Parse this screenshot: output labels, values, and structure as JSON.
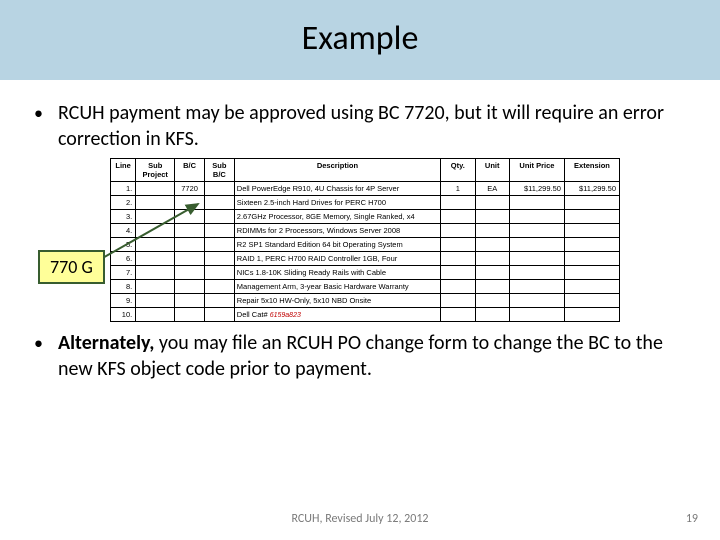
{
  "title": "Example",
  "bullets": {
    "b1": "RCUH payment may be approved using BC 7720, but it will require an error correction in KFS.",
    "b2_bold": "Alternately,",
    "b2_rest": " you may file an RCUH PO change form to change the BC to the new KFS object code prior to payment."
  },
  "callout": "770 G",
  "table": {
    "headers": {
      "line": "Line",
      "sub": "Sub Project",
      "bc": "B/C",
      "sbc": "Sub B/C",
      "desc": "Description",
      "qty": "Qty.",
      "unit": "Unit",
      "up": "Unit Price",
      "ext": "Extension"
    },
    "rows": [
      {
        "line": "1.",
        "sub": "",
        "bc": "7720",
        "sbc": "",
        "desc": "Dell PowerEdge R910, 4U Chassis for 4P Server",
        "qty": "1",
        "unit": "EA",
        "up": "$11,299.50",
        "ext": "$11,299.50"
      },
      {
        "line": "2.",
        "sub": "",
        "bc": "",
        "sbc": "",
        "desc": "Sixteen 2.5-inch Hard Drives for PERC H700",
        "qty": "",
        "unit": "",
        "up": "",
        "ext": ""
      },
      {
        "line": "3.",
        "sub": "",
        "bc": "",
        "sbc": "",
        "desc": "2.67GHz Processor, 8GE Memory, Single Ranked, x4",
        "qty": "",
        "unit": "",
        "up": "",
        "ext": ""
      },
      {
        "line": "4.",
        "sub": "",
        "bc": "",
        "sbc": "",
        "desc": "RDIMMs for 2 Processors, Windows Server 2008",
        "qty": "",
        "unit": "",
        "up": "",
        "ext": ""
      },
      {
        "line": "5.",
        "sub": "",
        "bc": "",
        "sbc": "",
        "desc": "R2 SP1 Standard Edition 64 bit Operating System",
        "qty": "",
        "unit": "",
        "up": "",
        "ext": ""
      },
      {
        "line": "6.",
        "sub": "",
        "bc": "",
        "sbc": "",
        "desc": "RAID 1, PERC H700 RAID Controller 1GB, Four",
        "qty": "",
        "unit": "",
        "up": "",
        "ext": ""
      },
      {
        "line": "7.",
        "sub": "",
        "bc": "",
        "sbc": "",
        "desc": "NICs 1.8-10K Sliding Ready Rails with Cable",
        "qty": "",
        "unit": "",
        "up": "",
        "ext": ""
      },
      {
        "line": "8.",
        "sub": "",
        "bc": "",
        "sbc": "",
        "desc": "Management Arm, 3-year Basic Hardware Warranty",
        "qty": "",
        "unit": "",
        "up": "",
        "ext": ""
      },
      {
        "line": "9.",
        "sub": "",
        "bc": "",
        "sbc": "",
        "desc": "Repair 5x10 HW-Only, 5x10 NBD Onsite",
        "qty": "",
        "unit": "",
        "up": "",
        "ext": ""
      },
      {
        "line": "10.",
        "sub": "",
        "bc": "",
        "sbc": "",
        "desc_plain": "Dell Cat# ",
        "desc_red": "6159a823",
        "qty": "",
        "unit": "",
        "up": "",
        "ext": ""
      }
    ]
  },
  "footer": {
    "center": "RCUH, Revised July 12, 2012",
    "page": "19"
  }
}
